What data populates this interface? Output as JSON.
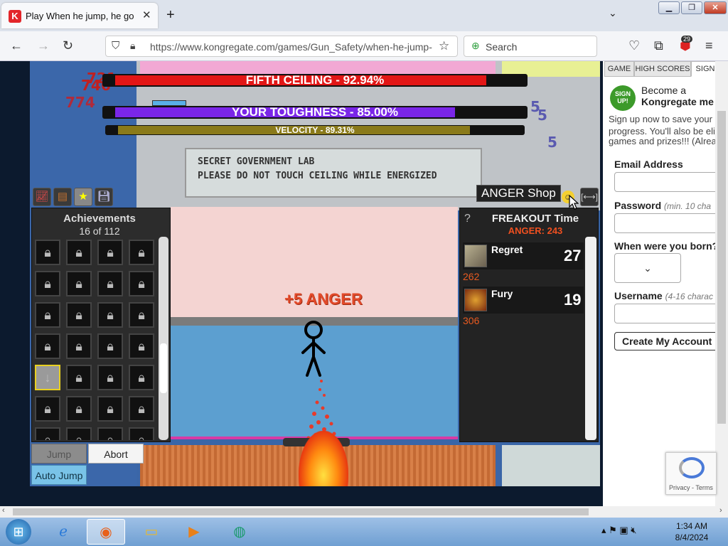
{
  "browser": {
    "tab_title": "Play When he jump, he go up ha",
    "tab_logo": "K",
    "url": "https://www.kongregate.com/games/Gun_Safety/when-he-jump-",
    "search_label": "Search",
    "extension_badge": "29"
  },
  "game": {
    "bars": [
      {
        "label": "FIFTH CEILING - 92.94%",
        "fill": 0.9294,
        "color": "#e21616"
      },
      {
        "label": "YOUR TOUGHNESS - 85.00%",
        "fill": 0.85,
        "color": "#7a26e8"
      },
      {
        "label": "VELOCITY - 89.31%",
        "fill": 0.8931,
        "color": "#8a7a1a"
      }
    ],
    "sign_lines": [
      "SECRET GOVERNMENT LAB",
      "PLEASE DO NOT TOUCH CEILING WHILE ENERGIZED"
    ],
    "damage_numbers": [
      "721",
      "746",
      "774"
    ],
    "blue_numbers": [
      "5",
      "5",
      "5"
    ],
    "floating_text": "+5 ANGER",
    "achievements": {
      "title": "Achievements",
      "count": "16 of 112"
    },
    "shop_label": "ANGER Shop",
    "freakout": {
      "question": "?",
      "title": "FREAKOUT Time",
      "anger": "ANGER: 243",
      "items": [
        {
          "name": "Regret",
          "count": "27",
          "cost": "262"
        },
        {
          "name": "Fury",
          "count": "19",
          "cost": "306"
        }
      ]
    },
    "buttons": {
      "jump": "Jump",
      "abort": "Abort",
      "auto_jump": "Auto Jump"
    }
  },
  "sidebar": {
    "tabs": [
      "GAME",
      "HIGH SCORES",
      "SIGN"
    ],
    "logo_text": "SIGN UP!",
    "become": "Become a",
    "kong": "Kongregate me",
    "promo_lines": [
      "Sign up now to save your",
      "progress. You'll also be elig",
      "games and prizes!!! (Alrea"
    ],
    "email_label": "Email Address",
    "password_label": "Password",
    "password_hint": "(min. 10 cha",
    "born_label": "When were you born?",
    "username_label": "Username",
    "username_hint": "(4-16 charac",
    "create_button": "Create My Account",
    "recaptcha_text": "Privacy - Terms"
  },
  "taskbar": {
    "time": "1:34 AM",
    "date": "8/4/2024"
  }
}
